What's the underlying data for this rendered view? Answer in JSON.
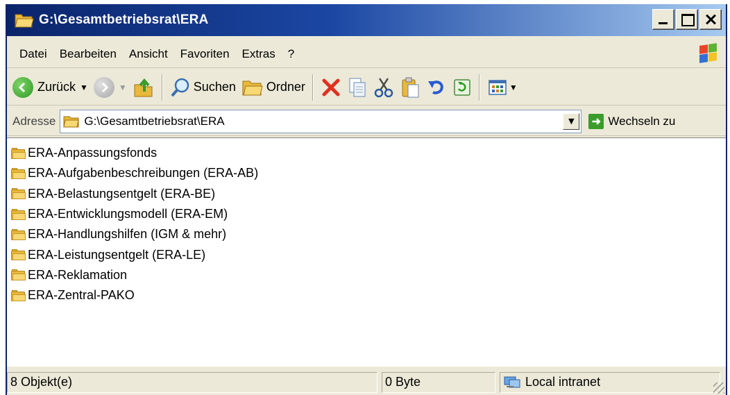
{
  "window": {
    "title": "G:\\Gesamtbetriebsrat\\ERA"
  },
  "menu": {
    "items": [
      "Datei",
      "Bearbeiten",
      "Ansicht",
      "Favoriten",
      "Extras",
      "?"
    ]
  },
  "toolbar": {
    "back_label": "Zurück",
    "search_label": "Suchen",
    "folders_label": "Ordner",
    "icons": [
      "back-icon",
      "forward-icon",
      "up-folder-icon",
      "search-icon",
      "folders-icon",
      "delete-icon",
      "copy-to-icon",
      "cut-icon",
      "paste-icon",
      "undo-icon",
      "refresh-icon",
      "views-icon"
    ]
  },
  "address": {
    "label": "Adresse",
    "value": "G:\\Gesamtbetriebsrat\\ERA",
    "go_label": "Wechseln zu"
  },
  "files": [
    {
      "name": "ERA-Anpassungsfonds"
    },
    {
      "name": "ERA-Aufgabenbeschreibungen (ERA-AB)"
    },
    {
      "name": "ERA-Belastungsentgelt (ERA-BE)"
    },
    {
      "name": "ERA-Entwicklungsmodell (ERA-EM)"
    },
    {
      "name": "ERA-Handlungshilfen (IGM & mehr)"
    },
    {
      "name": "ERA-Leistungsentgelt (ERA-LE)"
    },
    {
      "name": "ERA-Reklamation"
    },
    {
      "name": "ERA-Zentral-PAKO"
    }
  ],
  "status": {
    "objects": "8 Objekt(e)",
    "size": "0 Byte",
    "zone": "Local intranet"
  },
  "colors": {
    "title_start": "#0a246a",
    "title_end": "#a6caf0",
    "chrome": "#ece9d8",
    "folder": "#e8b93b"
  }
}
